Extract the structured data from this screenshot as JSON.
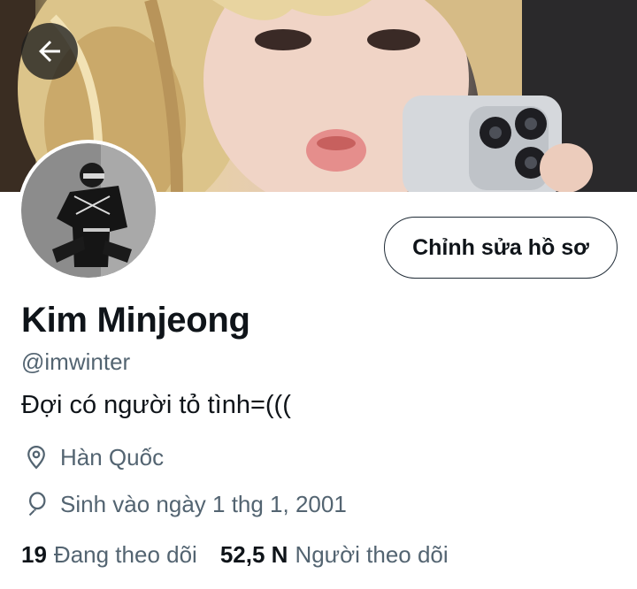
{
  "profile": {
    "name": "Kim Minjeong",
    "handle": "@imwinter",
    "bio": "Đợi có người tỏ tình=(((",
    "location": "Hàn Quốc",
    "birthday": "Sinh vào ngày 1 thg 1, 2001"
  },
  "actions": {
    "edit_profile_label": "Chỉnh sửa hồ sơ"
  },
  "stats": {
    "following_count": "19",
    "following_label": "Đang theo dõi",
    "followers_count": "52,5 N",
    "followers_label": "Người theo dõi"
  },
  "icons": {
    "back": "arrow-left-icon",
    "location": "location-pin-icon",
    "birthday": "balloon-icon"
  },
  "colors": {
    "text_primary": "#0f1419",
    "text_secondary": "#536471",
    "button_border": "#1f2b36"
  }
}
